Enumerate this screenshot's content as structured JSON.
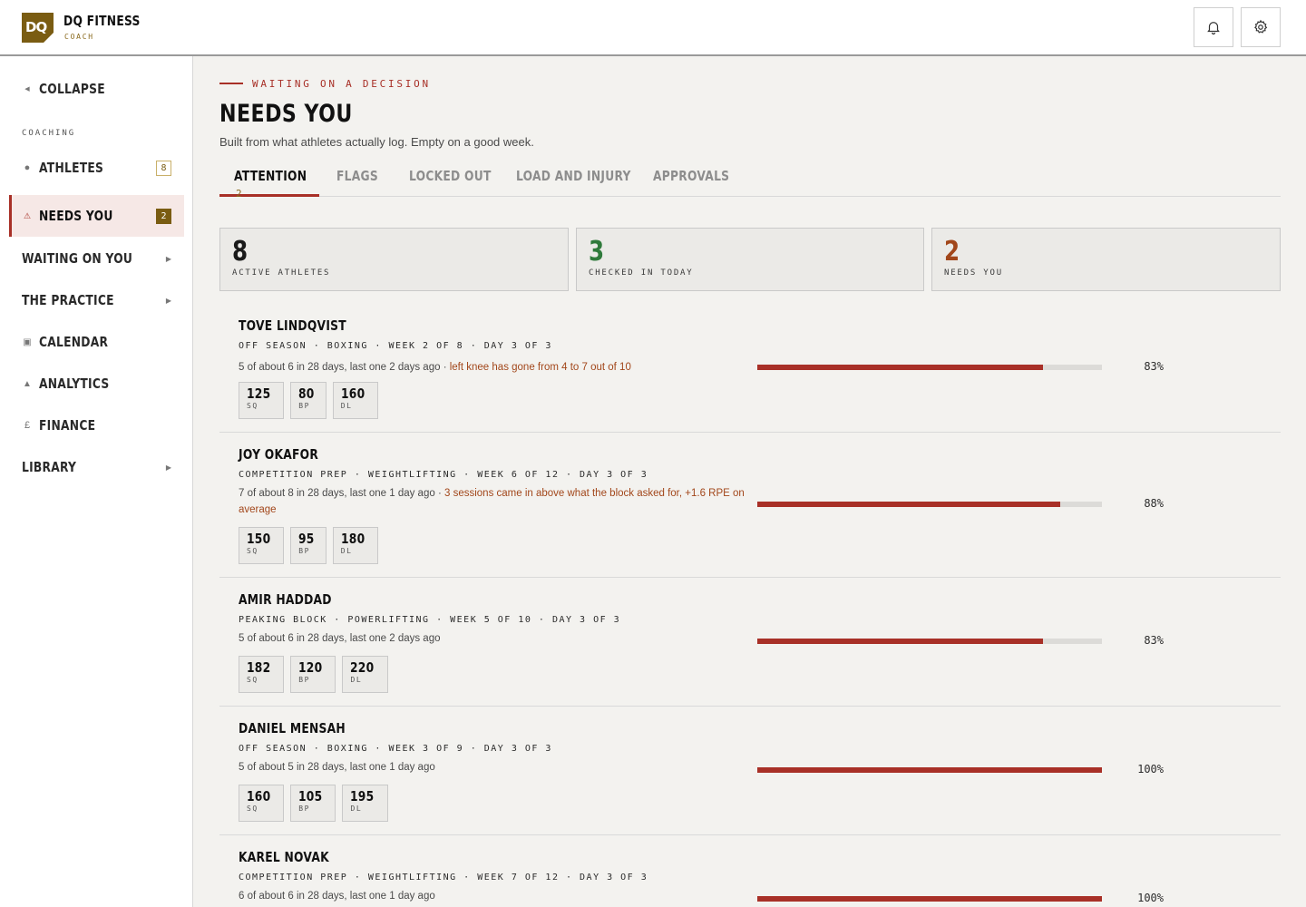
{
  "brand": {
    "logo": "DQ",
    "name": "DQ FITNESS",
    "role": "COACH"
  },
  "header": {
    "icons": [
      "bell-icon",
      "gear-icon"
    ]
  },
  "sidebar": {
    "collapse": "COLLAPSE",
    "section": "COACHING",
    "items": [
      {
        "label": "ATHLETES",
        "badge": "8"
      },
      {
        "label": "NEEDS YOU",
        "badge": "2"
      },
      {
        "label": "WAITING ON YOU"
      },
      {
        "label": "THE PRACTICE"
      },
      {
        "label": "CALENDAR"
      },
      {
        "label": "ANALYTICS"
      },
      {
        "label": "FINANCE"
      },
      {
        "label": "LIBRARY"
      }
    ]
  },
  "main": {
    "eyebrow": "WAITING ON A DECISION",
    "title": "NEEDS YOU",
    "subtitle": "Built from what athletes actually log. Empty on a good week.",
    "tabs": [
      {
        "label": "ATTENTION",
        "count": "2"
      },
      {
        "label": "FLAGS"
      },
      {
        "label": "LOCKED OUT"
      },
      {
        "label": "LOAD AND INJURY"
      },
      {
        "label": "APPROVALS"
      }
    ],
    "stats": [
      {
        "value": "8",
        "label": "ACTIVE ATHLETES"
      },
      {
        "value": "3",
        "label": "CHECKED IN TODAY"
      },
      {
        "value": "2",
        "label": "NEEDS YOU"
      }
    ],
    "athletes": [
      {
        "name": "TOVE LINDQVIST",
        "meta": "OFF SEASON · BOXING · WEEK 2 OF 8 · DAY 3 OF 3",
        "summary": "5 of about 6 in 28 days, last one 2 days ago",
        "flag": "left knee has gone from 4 to 7 out of 10",
        "lifts": [
          {
            "value": "125",
            "label": "SQ"
          },
          {
            "value": "80",
            "label": "BP"
          },
          {
            "value": "160",
            "label": "DL"
          }
        ],
        "adherence": 83,
        "adherence_label": "83%"
      },
      {
        "name": "JOY OKAFOR",
        "meta": "COMPETITION PREP · WEIGHTLIFTING · WEEK 6 OF 12 · DAY 3 OF 3",
        "summary": "7 of about 8 in 28 days, last one 1 day ago",
        "flag": "3 sessions came in above what the block asked for, +1.6 RPE on average",
        "lifts": [
          {
            "value": "150",
            "label": "SQ"
          },
          {
            "value": "95",
            "label": "BP"
          },
          {
            "value": "180",
            "label": "DL"
          }
        ],
        "adherence": 88,
        "adherence_label": "88%"
      },
      {
        "name": "AMIR HADDAD",
        "meta": "PEAKING BLOCK · POWERLIFTING · WEEK 5 OF 10 · DAY 3 OF 3",
        "summary": "5 of about 6 in 28 days, last one 2 days ago",
        "flag": "",
        "lifts": [
          {
            "value": "182",
            "label": "SQ"
          },
          {
            "value": "120",
            "label": "BP"
          },
          {
            "value": "220",
            "label": "DL"
          }
        ],
        "adherence": 83,
        "adherence_label": "83%"
      },
      {
        "name": "DANIEL MENSAH",
        "meta": "OFF SEASON · BOXING · WEEK 3 OF 9 · DAY 3 OF 3",
        "summary": "5 of about 5 in 28 days, last one 1 day ago",
        "flag": "",
        "lifts": [
          {
            "value": "160",
            "label": "SQ"
          },
          {
            "value": "105",
            "label": "BP"
          },
          {
            "value": "195",
            "label": "DL"
          }
        ],
        "adherence": 100,
        "adherence_label": "100%"
      },
      {
        "name": "KAREL NOVAK",
        "meta": "COMPETITION PREP · WEIGHTLIFTING · WEEK 7 OF 12 · DAY 3 OF 3",
        "summary": "6 of about 6 in 28 days, last one 1 day ago",
        "flag": "",
        "lifts": [],
        "adherence": 100,
        "adherence_label": "100%"
      }
    ]
  },
  "colors": {
    "accent": "#a83027",
    "brand": "#7a5c12",
    "green": "#2f7a3b",
    "rust": "#a2471b"
  }
}
